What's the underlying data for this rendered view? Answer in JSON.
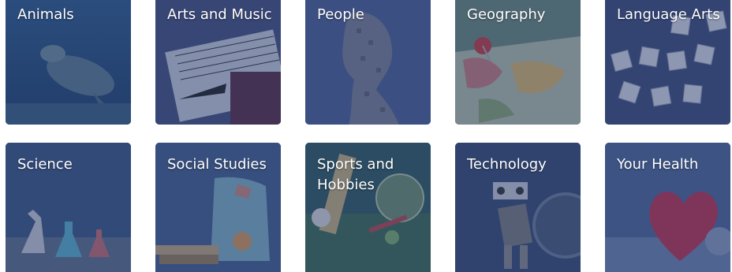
{
  "topics": [
    {
      "label": "Animals",
      "icon": "sea-turtle"
    },
    {
      "label": "Arts and Music",
      "icon": "sheet-music"
    },
    {
      "label": "People",
      "icon": "face-mosaic"
    },
    {
      "label": "Geography",
      "icon": "world-map"
    },
    {
      "label": "Language Arts",
      "icon": "letter-tiles"
    },
    {
      "label": "Science",
      "icon": "microscope"
    },
    {
      "label": "Social Studies",
      "icon": "backpack-books"
    },
    {
      "label": "Sports and Hobbies",
      "icon": "sports-gear"
    },
    {
      "label": "Technology",
      "icon": "robot"
    },
    {
      "label": "Your Health",
      "icon": "heart"
    }
  ],
  "colors": {
    "overlay": "#263a6e",
    "label_text": "#ffffff"
  }
}
